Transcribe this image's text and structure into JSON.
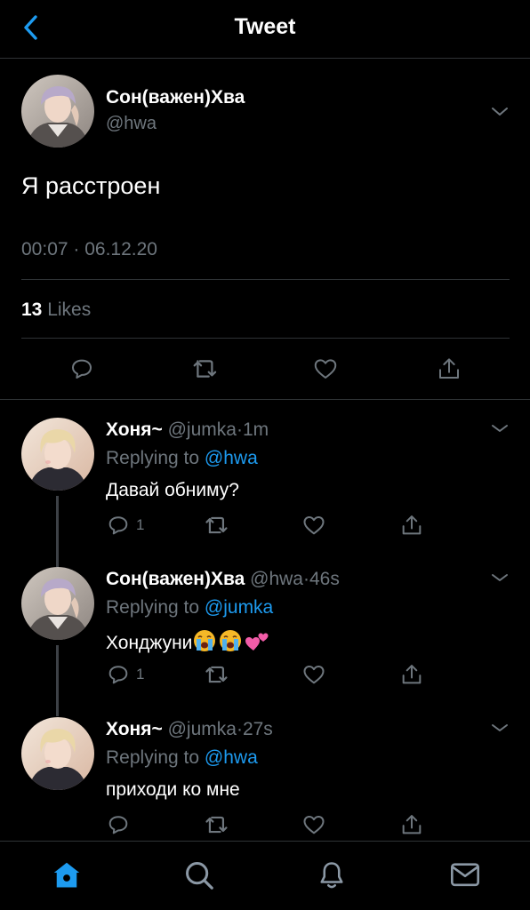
{
  "header": {
    "title": "Tweet",
    "back_icon": "chevron-left-icon",
    "accent": "#1d9bf0"
  },
  "tweet": {
    "author_name": "Сон(важен)Хва",
    "handle": "@hwa",
    "text": "Я расстроен",
    "timestamp": "00:07 · 06.12.20",
    "likes_count": "13",
    "likes_label": "Likes",
    "actions": [
      "reply-icon",
      "retweet-icon",
      "like-icon",
      "share-icon"
    ]
  },
  "replies": [
    {
      "author_name": "Хоня~",
      "handle": "@jumka",
      "separator": "·",
      "time": "1m",
      "replying_prefix": "Replying to",
      "replying_to": "@hwa",
      "text": "Давай обниму?",
      "reply_count": "1"
    },
    {
      "author_name": "Сон(важен)Хва",
      "handle": "@hwa",
      "separator": "·",
      "time": "46s",
      "replying_prefix": "Replying to",
      "replying_to": "@jumka",
      "text": "Хонджуни",
      "emojis": [
        "loudly-crying-face",
        "loudly-crying-face",
        "two-hearts"
      ],
      "reply_count": "1"
    },
    {
      "author_name": "Хоня~",
      "handle": "@jumka",
      "separator": "·",
      "time": "27s",
      "replying_prefix": "Replying to",
      "replying_to": "@hwa",
      "text": "приходи ко мне",
      "reply_count": ""
    }
  ],
  "tabbar": {
    "items": [
      "home-icon",
      "search-icon",
      "notifications-icon",
      "messages-icon"
    ],
    "active": "home-icon"
  }
}
